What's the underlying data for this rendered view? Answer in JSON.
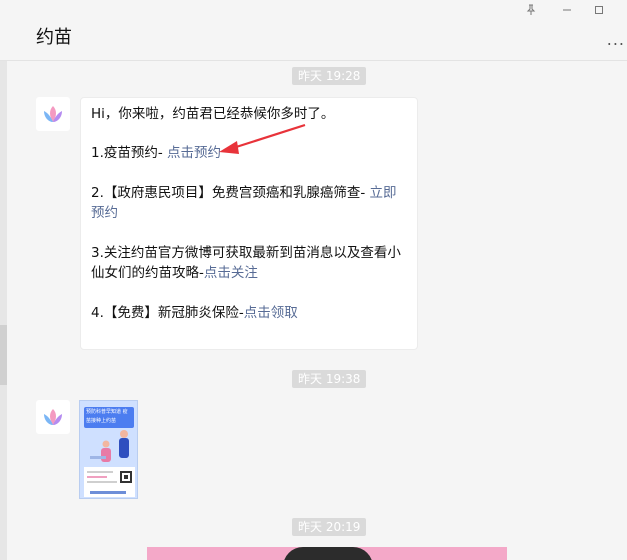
{
  "window": {
    "pin_icon": "pin-icon",
    "minimize_icon": "minimize-icon",
    "maximize_icon": "maximize-icon",
    "more_icon": "more-icon"
  },
  "chat": {
    "title": "约苗"
  },
  "messages": [
    {
      "time": "昨天 19:28",
      "greeting": "Hi，你来啦，约苗君已经恭候你多时了。",
      "item1_prefix": "1.疫苗预约- ",
      "item1_link": "点击预约",
      "item2_prefix": "2.【政府惠民项目】免费宫颈癌和乳腺癌筛查- ",
      "item2_link": "立即预约",
      "item3_prefix": "3.关注约苗官方微博可获取最新到苗消息以及查看小仙女们的约苗攻略-",
      "item3_link": "点击关注",
      "item4_prefix": "4.【免费】新冠肺炎保险-",
      "item4_link": "点击领取"
    },
    {
      "time": "昨天 19:38",
      "poster_text": "预防科普早知道 疫苗接种上约苗"
    },
    {
      "time": "昨天 20:19"
    }
  ],
  "colors": {
    "link": "#576b95",
    "arrow": "#e8333a",
    "poster_blue": "#4c7df0",
    "pink_card": "#f4a8c8"
  }
}
